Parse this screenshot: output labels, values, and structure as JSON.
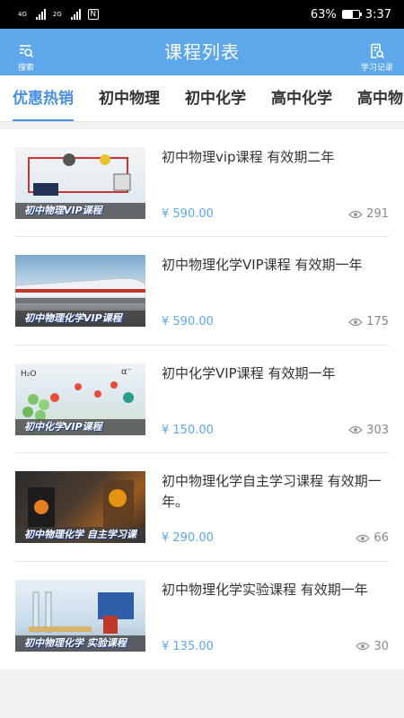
{
  "status_bar": {
    "net1": "4G",
    "net2": "2G",
    "nfc": "N",
    "battery_percent": "63%",
    "time": "3:37",
    "battery_level": 0.63
  },
  "header": {
    "title": "课程列表",
    "search_label": "搜索",
    "search_icon": "search-list-icon",
    "records_label": "学习记录",
    "records_icon": "document-search-icon"
  },
  "tabs": [
    {
      "label": "优惠热销",
      "active": true
    },
    {
      "label": "初中物理",
      "active": false
    },
    {
      "label": "初中化学",
      "active": false
    },
    {
      "label": "高中化学",
      "active": false
    },
    {
      "label": "高中物",
      "active": false
    }
  ],
  "courses": [
    {
      "title": "初中物理vip课程 有效期二年",
      "thumb_caption": "初中物理VIP课程",
      "price": "¥ 590.00",
      "views": "291"
    },
    {
      "title": "初中物理化学VIP课程 有效期一年",
      "thumb_caption": "初中物理化学VIP课程",
      "price": "¥ 590.00",
      "views": "175"
    },
    {
      "title": "初中化学VIP课程 有效期一年",
      "thumb_caption": "初中化学VIP课程",
      "price": "¥ 150.00",
      "views": "303"
    },
    {
      "title": "初中物理化学自主学习课程 有效期一年。",
      "thumb_caption": "初中物理化学 自主学习课程",
      "price": "¥ 290.00",
      "views": "66"
    },
    {
      "title": "初中物理化学实验课程 有效期一年",
      "thumb_caption": "初中物理化学 实验课程",
      "price": "¥ 135.00",
      "views": "30"
    }
  ],
  "colors": {
    "accent": "#5da7ea",
    "active_tab": "#4a90e2",
    "price": "#5da7ea"
  }
}
